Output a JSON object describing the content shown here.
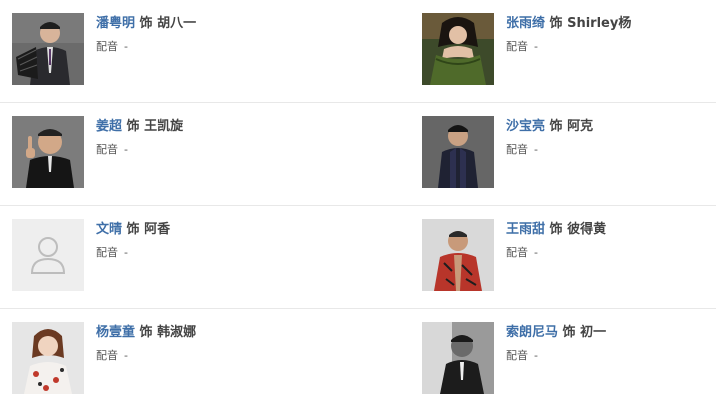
{
  "cast": [
    {
      "actor": "潘粤明",
      "role_word": "饰",
      "role": "胡八一",
      "va_label": "配音",
      "va_value": "-",
      "photo": "actor-portrait-fan",
      "bg": "#6b6b6b"
    },
    {
      "actor": "张雨绮",
      "role_word": "饰",
      "role": "Shirley杨",
      "va_label": "配音",
      "va_value": "-",
      "photo": "actress-portrait-green-dress",
      "bg": "#3d4a2a"
    },
    {
      "actor": "姜超",
      "role_word": "饰",
      "role": "王凯旋",
      "va_label": "配音",
      "va_value": "-",
      "photo": "actor-portrait-pointing",
      "bg": "#8a8a8a"
    },
    {
      "actor": "沙宝亮",
      "role_word": "饰",
      "role": "阿克",
      "va_label": "配音",
      "va_value": "-",
      "photo": "actor-portrait-dark-suit",
      "bg": "#5a5a5a"
    },
    {
      "actor": "文晴",
      "role_word": "饰",
      "role": "阿香",
      "va_label": "配音",
      "va_value": "-",
      "photo": "default-avatar-placeholder",
      "bg": "#eeeeee"
    },
    {
      "actor": "王雨甜",
      "role_word": "饰",
      "role": "彼得黄",
      "va_label": "配音",
      "va_value": "-",
      "photo": "actor-portrait-red-jacket",
      "bg": "#d9d9d9"
    },
    {
      "actor": "杨壹童",
      "role_word": "饰",
      "role": "韩淑娜",
      "va_label": "配音",
      "va_value": "-",
      "photo": "actress-portrait-floral",
      "bg": "#e6e6e6"
    },
    {
      "actor": "索朗尼马",
      "role_word": "饰",
      "role": "初一",
      "va_label": "配音",
      "va_value": "-",
      "photo": "actor-portrait-bw",
      "bg": "#9a9a9a"
    }
  ],
  "colors": {
    "actor_link": "#3f6fa8",
    "role_text": "#444444",
    "meta_text": "#555555",
    "divider": "#e8e8e8"
  }
}
